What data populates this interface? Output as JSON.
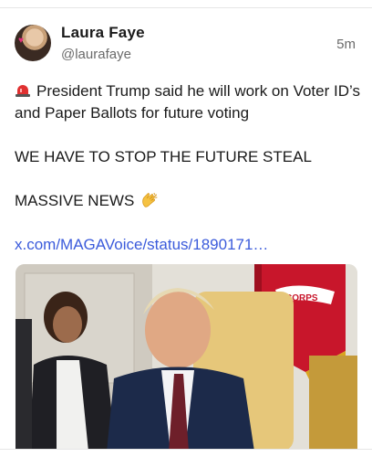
{
  "post": {
    "author_name": "Laura Faye",
    "author_handle": "@laurafaye",
    "timestamp": "5m",
    "text_line1": "President Trump said he will work on Voter ID’s and Paper Ballots for future voting",
    "text_line2": "WE HAVE TO STOP THE FUTURE STEAL",
    "text_line3": "MASSIVE NEWS",
    "link_text": "x.com/MAGAVoice/status/1890171…",
    "icons": {
      "leading_emoji": "police-siren-icon",
      "trailing_emoji": "clapping-hands-icon"
    },
    "media": {
      "flag_text": "CORPS"
    }
  },
  "colors": {
    "link": "#3b5bdb",
    "secondary_text": "#6b6b6b"
  }
}
